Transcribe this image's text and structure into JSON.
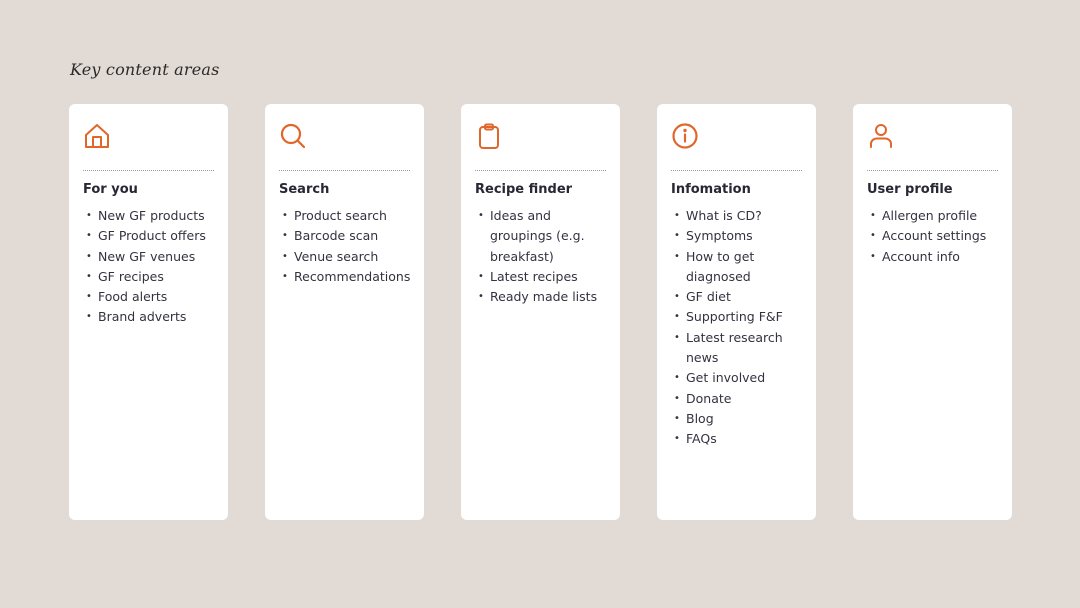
{
  "page": {
    "title": "Key content areas",
    "accent_color": "#e0662a",
    "background_color": "#e2dad5"
  },
  "cards": [
    {
      "icon": "home-icon",
      "title": "For you",
      "items": [
        "New GF products",
        "GF Product offers",
        "New GF venues",
        "GF recipes",
        "Food alerts",
        "Brand adverts"
      ]
    },
    {
      "icon": "search-icon",
      "title": "Search",
      "items": [
        "Product search",
        "Barcode scan",
        "Venue search",
        "Recommendations"
      ]
    },
    {
      "icon": "clipboard-icon",
      "title": "Recipe finder",
      "items": [
        "Ideas and groupings (e.g. breakfast)",
        "Latest recipes",
        "Ready made lists"
      ]
    },
    {
      "icon": "info-icon",
      "title": "Infomation",
      "items": [
        "What is CD?",
        "Symptoms",
        "How to get diagnosed",
        "GF diet",
        "Supporting F&F",
        "Latest research news",
        "Get involved",
        "Donate",
        "Blog",
        "FAQs"
      ]
    },
    {
      "icon": "user-icon",
      "title": "User profile",
      "items": [
        "Allergen profile",
        "Account settings",
        "Account info"
      ]
    }
  ]
}
